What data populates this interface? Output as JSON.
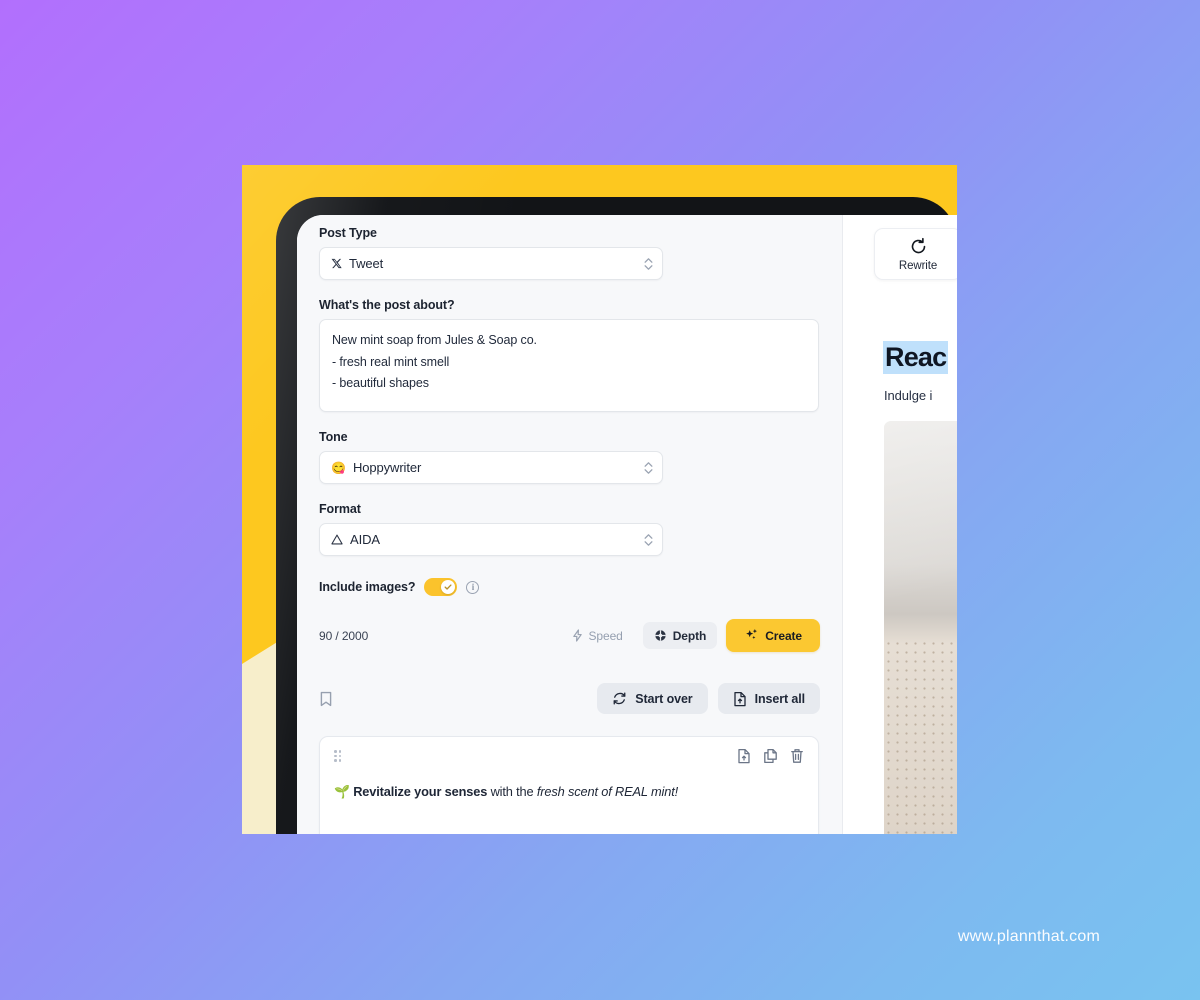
{
  "background": {
    "gradient_from": "#b26ffd",
    "gradient_to": "#79c3f0",
    "plate_color": "#fdc81f",
    "stripe_color": "#f7eecb",
    "bezel_color": "#121417"
  },
  "watermark": {
    "text": "www.plannthat.com"
  },
  "form": {
    "post_type": {
      "label": "Post Type",
      "icon": "x-twitter-icon",
      "value": "Tweet"
    },
    "about": {
      "label": "What's the post about?",
      "lines": [
        "New mint soap from Jules & Soap co.",
        "- fresh real mint smell",
        "- beautiful shapes"
      ]
    },
    "tone": {
      "label": "Tone",
      "icon": "😋",
      "value": "Hoppywriter"
    },
    "format": {
      "label": "Format",
      "icon": "triangle-warning-icon",
      "value": "AIDA"
    },
    "include_images": {
      "label": "Include images?",
      "enabled": true,
      "info_icon": "info-icon"
    },
    "counter": "90 / 2000",
    "buttons": {
      "speed": "Speed",
      "depth": "Depth",
      "create": "Create",
      "start_over": "Start over",
      "insert_all": "Insert all"
    },
    "accent_color": "#fbc831"
  },
  "result_card": {
    "text_emoji": "🌱",
    "text_bold": "Revitalize your senses",
    "text_plain": " with the ",
    "text_italic": "fresh scent of REAL mint!",
    "icons": [
      "export-icon",
      "copy-icon",
      "trash-icon"
    ],
    "drag_handle": "drag-handle-icon"
  },
  "preview": {
    "rewrite_label": "Rewrite",
    "title": "Reac",
    "subtitle": "Indulge i",
    "title_highlight_color": "#bfe0fb"
  }
}
